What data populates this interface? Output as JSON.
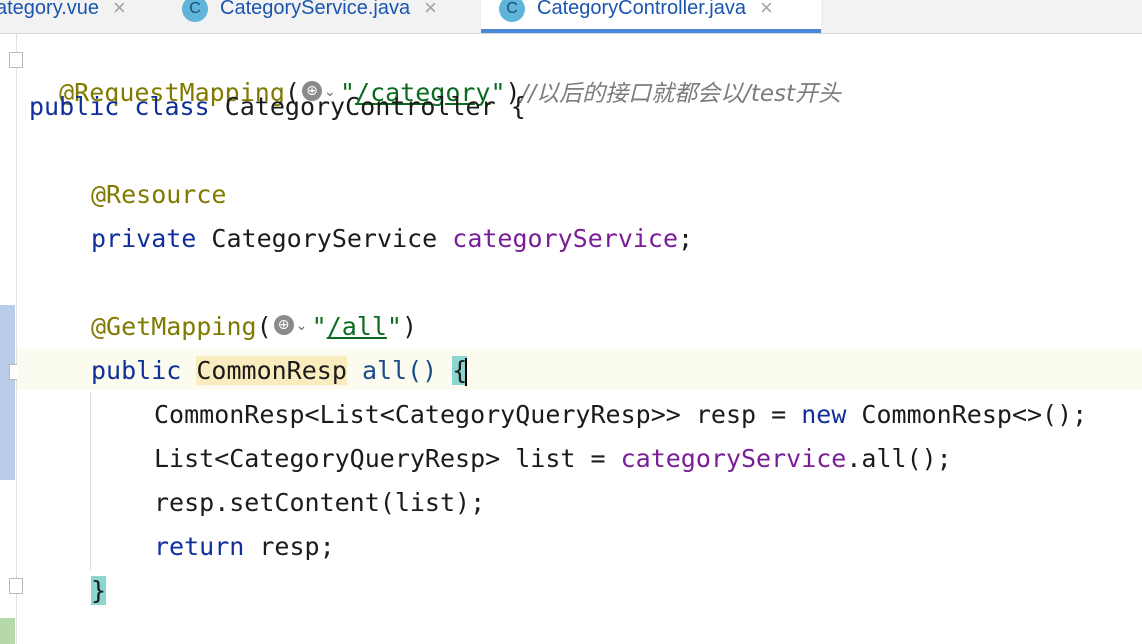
{
  "tabs": [
    {
      "label": "ategory.vue",
      "icon": "vue-file-icon",
      "active": false
    },
    {
      "label": "CategoryService.java",
      "icon": "java-class-icon",
      "active": false
    },
    {
      "label": "CategoryController.java",
      "icon": "java-class-icon",
      "active": true
    }
  ],
  "tab_icon_letter": "C",
  "close_glyph": "×",
  "code": {
    "l1": {
      "annotation": "@RequestMapping",
      "open": "(",
      "q1": "\"",
      "path": "/category",
      "q2": "\"",
      "close": ")",
      "comment": "//以后的接口就都会以/test开头"
    },
    "l2": {
      "kw1": "public",
      "kw2": "class",
      "name": "CategoryController",
      "brace": "{"
    },
    "l4": {
      "annotation": "@Resource"
    },
    "l5": {
      "kw": "private",
      "type": "CategoryService",
      "field": "categoryService",
      "semi": ";"
    },
    "l7": {
      "annotation": "@GetMapping",
      "open": "(",
      "q1": "\"",
      "path": "/all",
      "q2": "\"",
      "close": ")"
    },
    "l8": {
      "kw": "public",
      "type": "CommonResp",
      "method": "all()",
      "brace": "{"
    },
    "l9": {
      "a": "CommonResp<List<CategoryQueryResp>> resp = ",
      "kw": "new",
      "b": " CommonResp<>();"
    },
    "l10": {
      "a": "List<CategoryQueryResp> list = ",
      "field": "categoryService",
      "b": ".all();"
    },
    "l11": {
      "text": "resp.setContent(list);"
    },
    "l12": {
      "kw": "return",
      "text": " resp;"
    },
    "l13": {
      "brace": "}"
    }
  },
  "icons": {
    "globe": "globe-icon",
    "chevron": "chevron-down-icon"
  },
  "globe_glyph": "⊕",
  "chevron_glyph": "⌄",
  "colors": {
    "keyword": "#102f9c",
    "annotation": "#817a00",
    "string": "#0b6b1e",
    "field": "#7a1e98",
    "comment": "#7c7c7c",
    "tab_active_underline": "#4a86d8",
    "brace_match": "#8cd6d2"
  }
}
